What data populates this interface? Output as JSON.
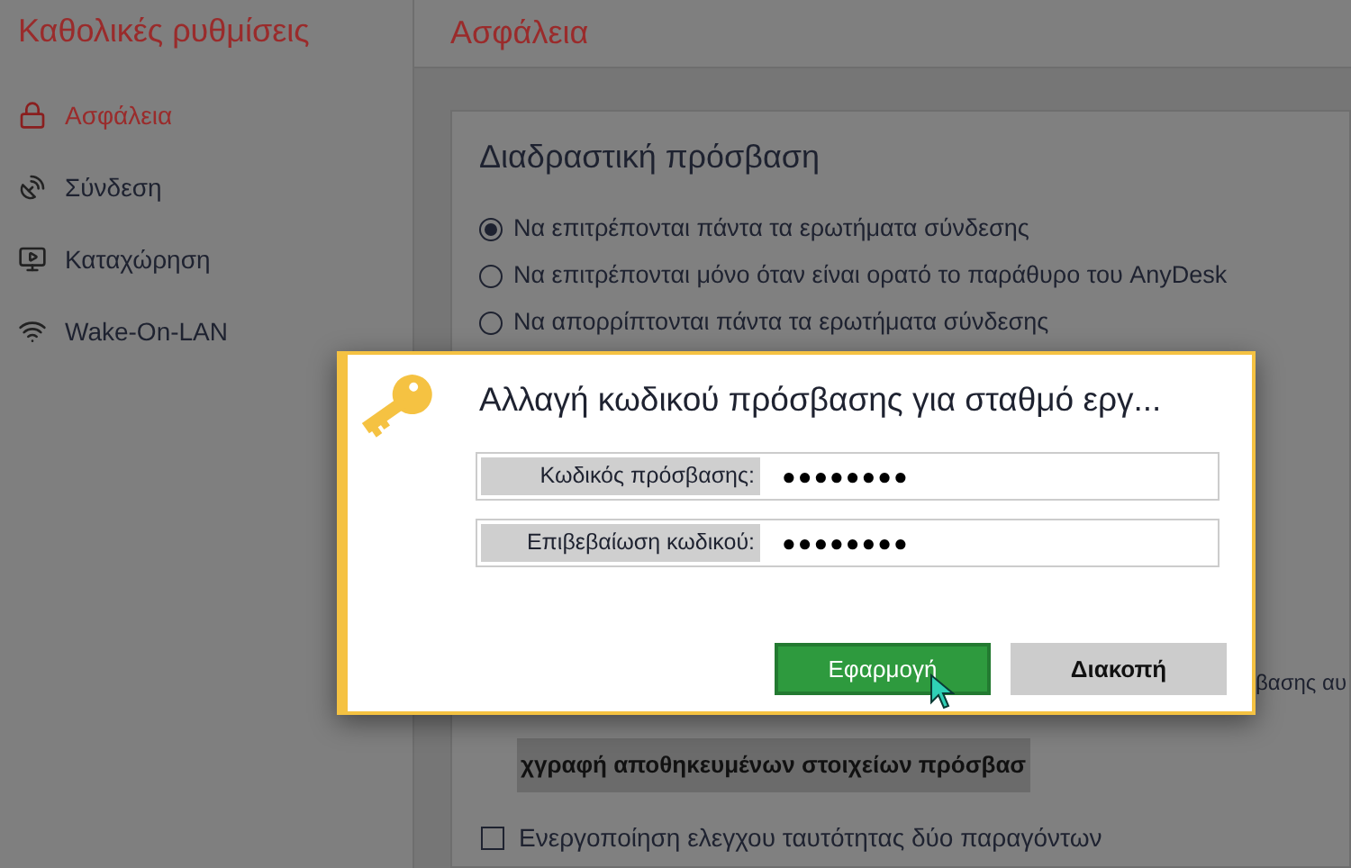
{
  "sidebar": {
    "title": "Καθολικές ρυθμίσεις",
    "items": [
      {
        "label": "Ασφάλεια",
        "selected": true
      },
      {
        "label": "Σύνδεση",
        "selected": false
      },
      {
        "label": "Καταχώρηση",
        "selected": false
      },
      {
        "label": "Wake-On-LAN",
        "selected": false
      }
    ]
  },
  "page": {
    "title": "Ασφάλεια"
  },
  "card": {
    "title": "Διαδραστική πρόσβαση",
    "options": [
      {
        "label": "Να επιτρέπονται πάντα τα ερωτήματα σύνδεσης",
        "selected": true
      },
      {
        "label": "Να επιτρέπονται μόνο όταν είναι ορατό το παράθυρο του AnyDesk",
        "selected": false
      },
      {
        "label": "Να απορρίπτονται πάντα τα ερωτήματα σύνδεσης",
        "selected": false
      }
    ],
    "partial_text": "βασης αυ",
    "clear_button": "χγραφή αποθηκευμένων στοιχείων πρόσβασ",
    "two_factor": {
      "label": "Ενεργοποίηση ελεγχου ταυτότητας δύο παραγόντων",
      "checked": false
    }
  },
  "dialog": {
    "title": "Αλλαγή κωδικού πρόσβασης για σταθμό εργ...",
    "fields": [
      {
        "label": "Κωδικός πρόσβασης:",
        "value": "●●●●●●●●"
      },
      {
        "label": "Επιβεβαίωση κωδικού:",
        "value": "●●●●●●●●"
      }
    ],
    "buttons": [
      {
        "label": "Εφαρμογή",
        "kind": "primary"
      },
      {
        "label": "Διακοπή",
        "kind": "secondary"
      }
    ]
  }
}
